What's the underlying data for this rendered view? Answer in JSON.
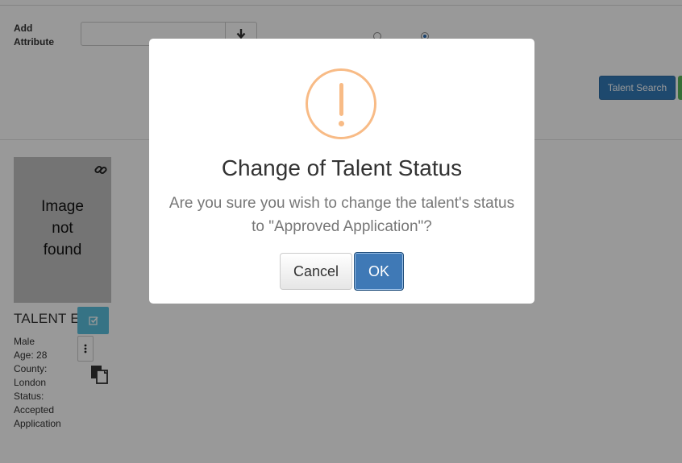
{
  "filters": {
    "add_attribute_label": "Add\nAttribute",
    "add_attribute_value": "",
    "talent_search_label": "Talent Search"
  },
  "talent": {
    "image_placeholder": "Image\nnot\nfound",
    "name": "TALENT E",
    "details": [
      "Male",
      "Age: 28",
      "County:",
      "London",
      "Status:",
      "Accepted",
      "Application"
    ]
  },
  "dialog": {
    "title": "Change of Talent Status",
    "message": "Are you sure you wish to change the talent's status to \"Approved Application\"?",
    "cancel_label": "Cancel",
    "ok_label": "OK",
    "icon": "warning-icon"
  },
  "colors": {
    "primary": "#337ab7",
    "info": "#5bc0de",
    "success": "#5cb85c",
    "warning": "#f8bb86"
  }
}
